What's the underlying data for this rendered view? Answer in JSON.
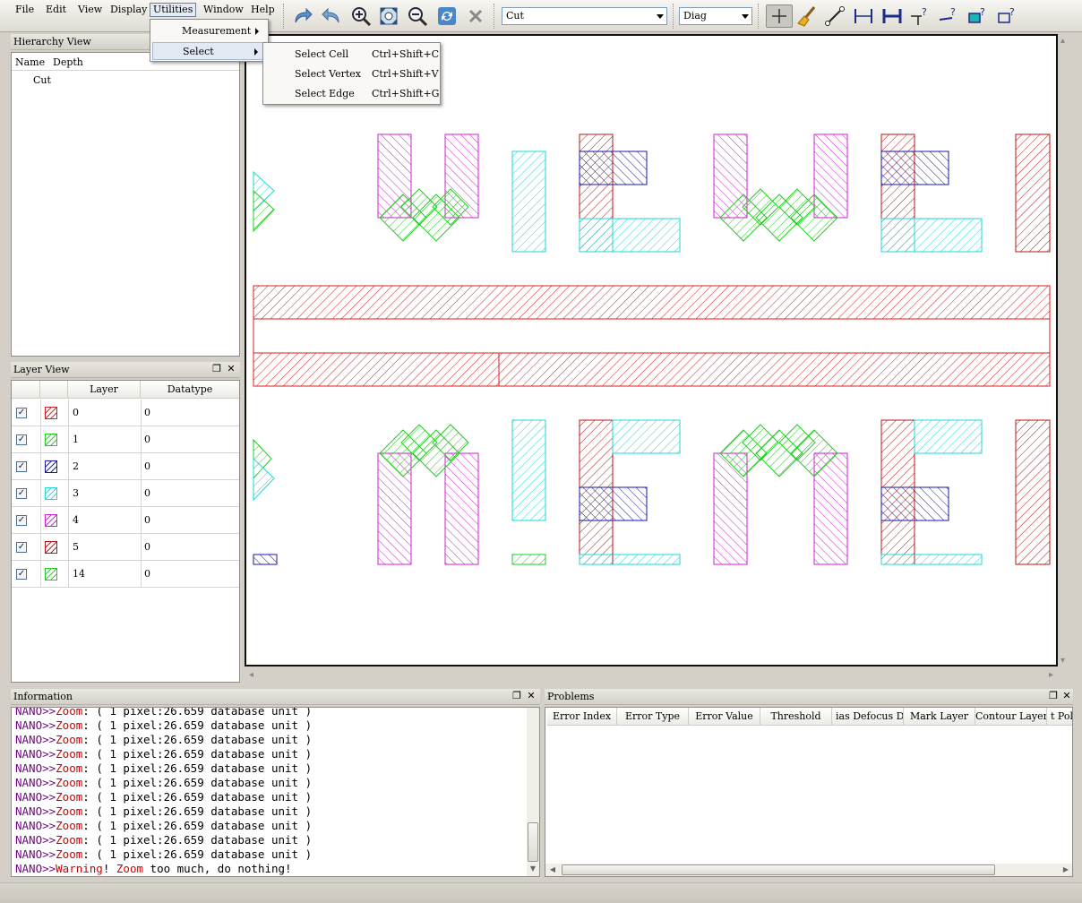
{
  "menubar": {
    "items": [
      "File",
      "Edit",
      "View",
      "Display",
      "Utilities",
      "Window",
      "Help"
    ],
    "active": "Utilities"
  },
  "toolbar": {
    "cell_combo": "Cut",
    "pattern_combo": "Diag",
    "icons": [
      "redo-icon",
      "undo-icon",
      "zoom-in-icon",
      "fit-icon",
      "zoom-out-icon",
      "refresh-icon",
      "stop-icon",
      "select-cursor-icon",
      "clear-brush-icon",
      "measure-line-icon",
      "measure-h-icon",
      "measure-h-bold-icon",
      "measure-vertex-icon",
      "measure-edge-icon",
      "layer-query-icon",
      "box-query-icon"
    ]
  },
  "utilities_menu": {
    "items": [
      {
        "label": "Measurement",
        "submenu": true
      },
      {
        "label": "Select",
        "submenu": true
      }
    ]
  },
  "select_submenu": {
    "items": [
      {
        "label": "Select Cell",
        "shortcut": "Ctrl+Shift+C"
      },
      {
        "label": "Select Vertex",
        "shortcut": "Ctrl+Shift+V"
      },
      {
        "label": "Select Edge",
        "shortcut": "Ctrl+Shift+G"
      }
    ]
  },
  "hierarchy": {
    "title": "Hierarchy View",
    "columns": [
      "Name",
      "Depth"
    ],
    "rows": [
      "Cut"
    ]
  },
  "layer_view": {
    "title": "Layer View",
    "columns": [
      "Layer",
      "Datatype"
    ],
    "rows": [
      {
        "layer": "0",
        "datatype": "0",
        "color": "#d42020",
        "checked": true
      },
      {
        "layer": "1",
        "datatype": "0",
        "color": "#22cc22",
        "checked": true
      },
      {
        "layer": "2",
        "datatype": "0",
        "color": "#1a1aa8",
        "checked": true
      },
      {
        "layer": "3",
        "datatype": "0",
        "color": "#22d6d6",
        "checked": true
      },
      {
        "layer": "4",
        "datatype": "0",
        "color": "#d020d0",
        "checked": true
      },
      {
        "layer": "5",
        "datatype": "0",
        "color": "#b01818",
        "checked": true
      },
      {
        "layer": "14",
        "datatype": "0",
        "color": "#22cc22",
        "checked": true
      }
    ]
  },
  "information": {
    "title": "Information",
    "lines": [
      {
        "prefix": "NANO>>",
        "kw": "Zoom",
        "rest": ": ( 1 pixel:26.659 database unit )"
      },
      {
        "prefix": "NANO>>",
        "kw": "Zoom",
        "rest": ": ( 1 pixel:26.659 database unit )"
      },
      {
        "prefix": "NANO>>",
        "kw": "Zoom",
        "rest": ": ( 1 pixel:26.659 database unit )"
      },
      {
        "prefix": "NANO>>",
        "kw": "Zoom",
        "rest": ": ( 1 pixel:26.659 database unit )"
      },
      {
        "prefix": "NANO>>",
        "kw": "Zoom",
        "rest": ": ( 1 pixel:26.659 database unit )"
      },
      {
        "prefix": "NANO>>",
        "kw": "Zoom",
        "rest": ": ( 1 pixel:26.659 database unit )"
      },
      {
        "prefix": "NANO>>",
        "kw": "Zoom",
        "rest": ": ( 1 pixel:26.659 database unit )"
      },
      {
        "prefix": "NANO>>",
        "kw": "Zoom",
        "rest": ": ( 1 pixel:26.659 database unit )"
      },
      {
        "prefix": "NANO>>",
        "kw": "Zoom",
        "rest": ": ( 1 pixel:26.659 database unit )"
      },
      {
        "prefix": "NANO>>",
        "kw": "Zoom",
        "rest": ": ( 1 pixel:26.659 database unit )"
      },
      {
        "prefix": "NANO>>",
        "kw": "Zoom",
        "rest": ": ( 1 pixel:26.659 database unit )"
      },
      {
        "prefix": "NANO>>",
        "kw": "Warning",
        "rest": "! ",
        "kw2": "Zoom",
        "rest2": " too much, do nothing!"
      }
    ]
  },
  "problems": {
    "title": "Problems",
    "columns": [
      "Error Index",
      "Error Type",
      "Error Value",
      "Threshold",
      "ias Defocus Dos",
      "Mark Layer",
      "Contour Layer",
      "t Poly"
    ]
  },
  "colors": {
    "red": "#d42020",
    "green": "#22cc22",
    "blue": "#1a1aa8",
    "cyan": "#22d6d6",
    "magenta": "#d020d0",
    "darkred": "#b01818"
  }
}
